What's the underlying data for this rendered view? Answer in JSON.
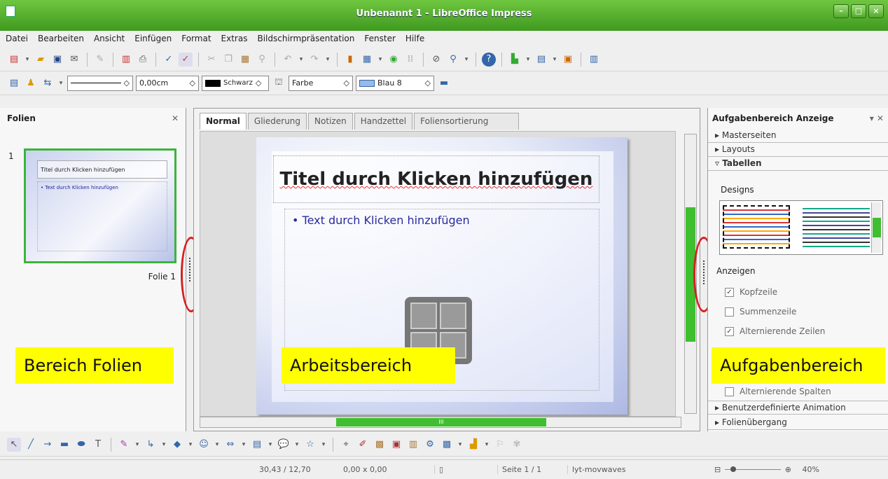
{
  "window": {
    "title": "Unbenannt 1 - LibreOffice Impress"
  },
  "menu": [
    "Datei",
    "Bearbeiten",
    "Ansicht",
    "Einfügen",
    "Format",
    "Extras",
    "Bildschirmpräsentation",
    "Fenster",
    "Hilfe"
  ],
  "toolbar2": {
    "line_width": "0,00cm",
    "line_color": "Schwarz",
    "area_style": "Farbe",
    "area_color": "Blau 8"
  },
  "left_panel": {
    "title": "Folien",
    "slide_number": "1",
    "slide_label": "Folie 1",
    "thumb_title": "Titel durch Klicken hinzufügen",
    "thumb_body": "• Text durch Klicken hinzufügen"
  },
  "work": {
    "tabs": [
      "Normal",
      "Gliederung",
      "Notizen",
      "Handzettel",
      "Foliensortierung"
    ],
    "slide_title": "Titel durch Klicken hinzufügen",
    "slide_body": "• Text durch Klicken hinzufügen"
  },
  "right_panel": {
    "header": "Aufgabenbereich Anzeige",
    "decks": [
      "Masterseiten",
      "Layouts",
      "Tabellen"
    ],
    "designs_label": "Designs",
    "show_label": "Anzeigen",
    "options": [
      {
        "label": "Kopfzeile",
        "checked": true
      },
      {
        "label": "Summenzeile",
        "checked": false
      },
      {
        "label": "Alternierende Zeilen",
        "checked": true
      },
      {
        "label": "Alternierende Spalten",
        "checked": false
      }
    ],
    "bottom_decks": [
      "Benutzerdefinierte Animation",
      "Folienübergang"
    ]
  },
  "overlays": {
    "left": "Bereich Folien",
    "center": "Arbeitsbereich",
    "right": "Aufgabenbereich"
  },
  "status": {
    "position": "30,43 / 12,70",
    "size": "0,00 x 0,00",
    "page": "Seite 1 / 1",
    "layout": "lyt-movwaves",
    "zoom": "40%"
  },
  "colors": {
    "titlebar": "#4fae2b",
    "annotation": "#ffff00",
    "ring": "#d42020",
    "scroll_thumb": "#3fbf2f"
  }
}
